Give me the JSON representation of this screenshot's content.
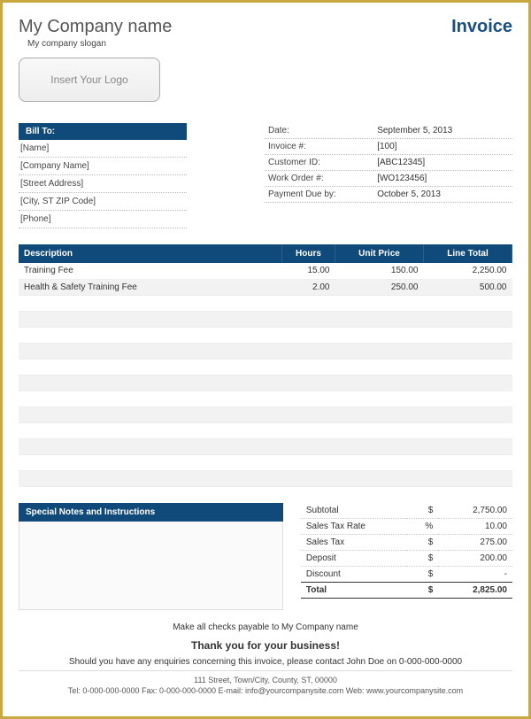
{
  "header": {
    "company_name": "My Company name",
    "slogan": "My company slogan",
    "title": "Invoice",
    "logo_placeholder": "Insert Your Logo"
  },
  "bill_to": {
    "header": "Bill To:",
    "lines": [
      "[Name]",
      "[Company Name]",
      "[Street Address]",
      "[City, ST  ZIP Code]",
      "[Phone]"
    ]
  },
  "meta": [
    {
      "label": "Date:",
      "value": "September 5, 2013"
    },
    {
      "label": "Invoice #:",
      "value": "[100]"
    },
    {
      "label": "Customer ID:",
      "value": "[ABC12345]"
    },
    {
      "label": "Work Order #:",
      "value": "[WO123456]"
    },
    {
      "label": "Payment Due by:",
      "value": "October 5, 2013"
    }
  ],
  "table": {
    "headers": {
      "desc": "Description",
      "hours": "Hours",
      "price": "Unit Price",
      "total": "Line Total"
    },
    "rows": [
      {
        "desc": "Training Fee",
        "hours": "15.00",
        "price": "150.00",
        "total": "2,250.00"
      },
      {
        "desc": "Health & Safety Training Fee",
        "hours": "2.00",
        "price": "250.00",
        "total": "500.00"
      },
      {
        "desc": "",
        "hours": "",
        "price": "",
        "total": ""
      },
      {
        "desc": "",
        "hours": "",
        "price": "",
        "total": ""
      },
      {
        "desc": "",
        "hours": "",
        "price": "",
        "total": ""
      },
      {
        "desc": "",
        "hours": "",
        "price": "",
        "total": ""
      },
      {
        "desc": "",
        "hours": "",
        "price": "",
        "total": ""
      },
      {
        "desc": "",
        "hours": "",
        "price": "",
        "total": ""
      },
      {
        "desc": "",
        "hours": "",
        "price": "",
        "total": ""
      },
      {
        "desc": "",
        "hours": "",
        "price": "",
        "total": ""
      },
      {
        "desc": "",
        "hours": "",
        "price": "",
        "total": ""
      },
      {
        "desc": "",
        "hours": "",
        "price": "",
        "total": ""
      },
      {
        "desc": "",
        "hours": "",
        "price": "",
        "total": ""
      },
      {
        "desc": "",
        "hours": "",
        "price": "",
        "total": ""
      }
    ]
  },
  "notes": {
    "header": "Special Notes and Instructions"
  },
  "totals": [
    {
      "lbl": "Subtotal",
      "sym": "$",
      "val": "2,750.00"
    },
    {
      "lbl": "Sales Tax Rate",
      "sym": "%",
      "val": "10.00"
    },
    {
      "lbl": "Sales Tax",
      "sym": "$",
      "val": "275.00"
    },
    {
      "lbl": "Deposit",
      "sym": "$",
      "val": "200.00"
    },
    {
      "lbl": "Discount",
      "sym": "$",
      "val": "-"
    }
  ],
  "grand_total": {
    "lbl": "Total",
    "sym": "$",
    "val": "2,825.00"
  },
  "footer": {
    "payable": "Make all checks payable to My Company name",
    "thanks": "Thank you for your business!",
    "enquiry": "Should you have any enquiries concerning this invoice, please contact John Doe on 0-000-000-0000",
    "address": "111 Street, Town/City, County, ST, 00000",
    "contact": "Tel: 0-000-000-0000 Fax: 0-000-000-0000 E-mail: info@yourcompanysite.com Web: www.yourcompanysite.com"
  }
}
